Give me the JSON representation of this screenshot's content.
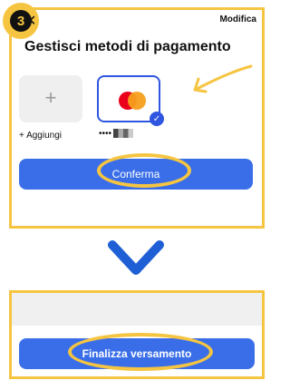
{
  "step": {
    "number": "3"
  },
  "header": {
    "close_glyph": "✕",
    "modify_label": "Modifica"
  },
  "title": "Gestisci metodi di pagamento",
  "cards": {
    "add_glyph": "+",
    "add_label": "+ Aggiungi",
    "card_mask": "••••",
    "selected_check": "✓"
  },
  "buttons": {
    "confirm_label": "Conferma",
    "finalize_label": "Finalizza versamento"
  },
  "colors": {
    "highlight": "#f5c542",
    "primary": "#3a6ee8",
    "chevron": "#1f5fd6",
    "mastercard_red": "#eb001b",
    "mastercard_orange": "#f79e1b"
  },
  "icons": [
    "close-icon",
    "plus-icon",
    "mastercard-logo",
    "check-icon",
    "chevron-down-icon",
    "pointer-arrow-icon"
  ]
}
